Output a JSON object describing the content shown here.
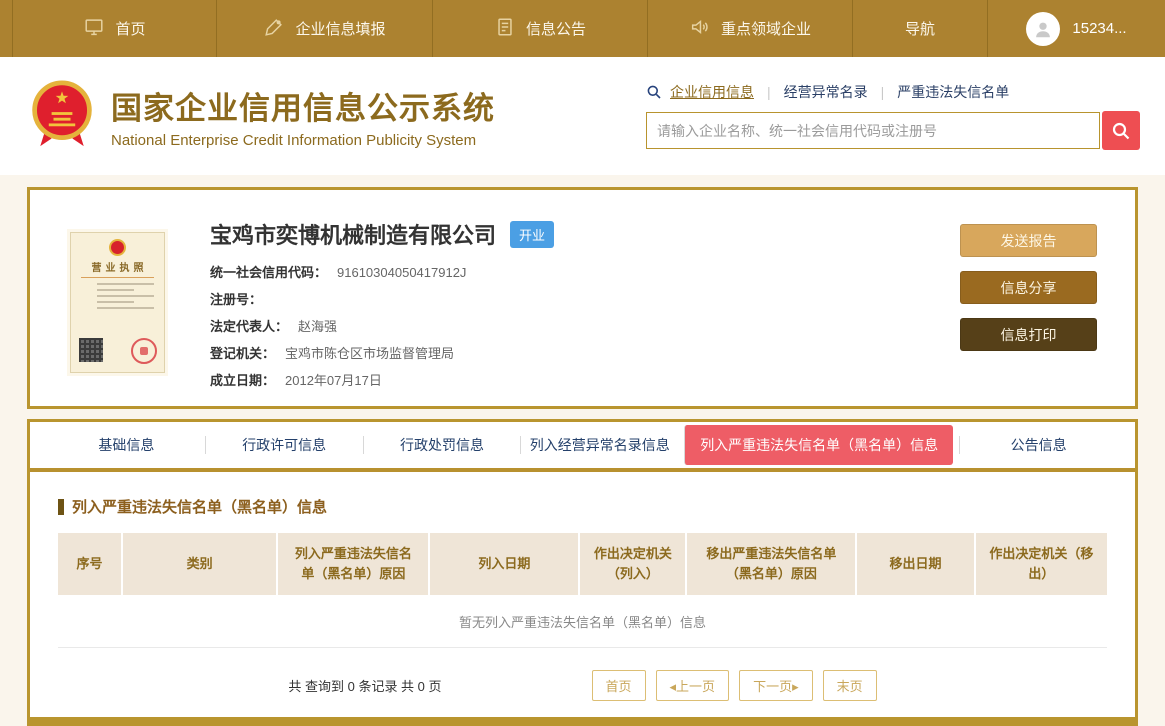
{
  "topnav": {
    "items": [
      {
        "label": "首页",
        "icon": "monitor-icon"
      },
      {
        "label": "企业信息填报",
        "icon": "pen-icon"
      },
      {
        "label": "信息公告",
        "icon": "document-icon"
      },
      {
        "label": "重点领域企业",
        "icon": "speaker-icon"
      },
      {
        "label": "导航",
        "icon": ""
      }
    ],
    "user": {
      "label": "15234..."
    }
  },
  "header": {
    "title": "国家企业信用信息公示系统",
    "subtitle": "National Enterprise Credit Information Publicity System",
    "search_tabs": [
      {
        "label": "企业信用信息",
        "active": true
      },
      {
        "label": "经营异常名录"
      },
      {
        "label": "严重违法失信名单"
      }
    ],
    "search_placeholder": "请输入企业名称、统一社会信用代码或注册号"
  },
  "company": {
    "name": "宝鸡市奕博机械制造有限公司",
    "status_badge": "开业",
    "license_title": "营业执照",
    "fields": [
      {
        "label": "统一社会信用代码：",
        "value": "91610304050417912J"
      },
      {
        "label": "注册号：",
        "value": ""
      },
      {
        "label": "法定代表人：",
        "value": "赵海强"
      },
      {
        "label": "登记机关：",
        "value": "宝鸡市陈仓区市场监督管理局"
      },
      {
        "label": "成立日期：",
        "value": "2012年07月17日"
      }
    ],
    "actions": [
      {
        "label": "发送报告",
        "color": "#D8A75C"
      },
      {
        "label": "信息分享",
        "color": "#9A6A20"
      },
      {
        "label": "信息打印",
        "color": "#564018"
      }
    ]
  },
  "tabs": [
    {
      "label": "基础信息"
    },
    {
      "label": "行政许可信息"
    },
    {
      "label": "行政处罚信息"
    },
    {
      "label": "列入经营异常名录信息"
    },
    {
      "label": "列入严重违法失信名单（黑名单）信息",
      "active": true
    },
    {
      "label": "公告信息"
    }
  ],
  "section": {
    "title": "列入严重违法失信名单（黑名单）信息",
    "table_headers": [
      "序号",
      "类别",
      "列入严重违法失信名单（黑名单）原因",
      "列入日期",
      "作出决定机关（列入）",
      "移出严重违法失信名单（黑名单）原因",
      "移出日期",
      "作出决定机关（移出）"
    ],
    "empty_message": "暂无列入严重违法失信名单（黑名单）信息",
    "record_summary": "共 查询到 0 条记录 共 0 页",
    "pagination": [
      {
        "label": "首页"
      },
      {
        "label": "◂上一页"
      },
      {
        "label": "下一页▸"
      },
      {
        "label": "末页"
      }
    ]
  },
  "colors": {
    "nav_gold": "#AC8230",
    "card_border_gold": "#B9952F",
    "active_tab_red": "#EE5D66",
    "badge_blue": "#4B9FE4",
    "search_button_red": "#EE4E52",
    "table_header_tan": "#EFE5D7",
    "title_brown": "#8C6A1E"
  }
}
